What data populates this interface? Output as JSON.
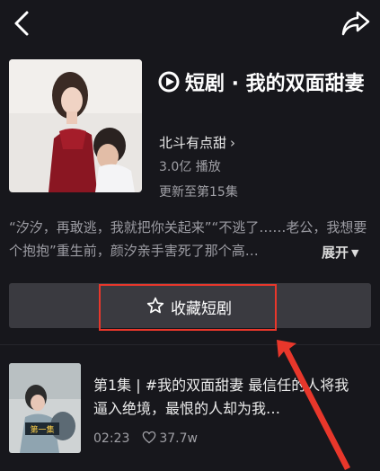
{
  "header": {
    "back_icon": "chevron-left-icon",
    "share_icon": "share-arrow-icon"
  },
  "drama": {
    "title": "短剧 · 我的双面甜妻",
    "author": "北斗有点甜",
    "plays": "3.0亿 播放",
    "updated": "更新至第15集",
    "description": "“汐汐，再敢逃，我就把你关起来”“不逃了……老公，我想要个抱抱”重生前，颜汐亲手害死了那个高…",
    "expand_label": "展开"
  },
  "favorite": {
    "label": "收藏短剧",
    "icon": "star-outline-icon"
  },
  "episode": {
    "text": "第1集 | #我的双面甜妻 最信任的人将我逼入绝境，最恨的人却为我…",
    "duration": "02:23",
    "likes": "37.7w",
    "thumb_caption": "第一集"
  },
  "colors": {
    "background": "#17171c",
    "button": "#3a3a40",
    "highlight_red": "#e8372b"
  }
}
